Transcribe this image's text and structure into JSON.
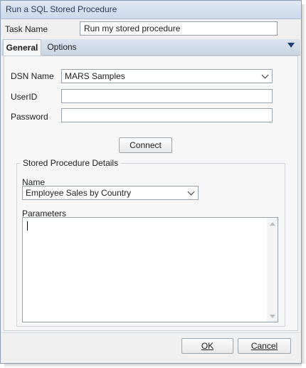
{
  "window": {
    "title": "Run a SQL Stored Procedure"
  },
  "task": {
    "label": "Task Name",
    "value": "Run my stored procedure"
  },
  "tabs": [
    {
      "label": "General"
    },
    {
      "label": "Options"
    }
  ],
  "connection": {
    "dsn_label": "DSN Name",
    "dsn_value": "MARS Samples",
    "userid_label": "UserID",
    "userid_value": "",
    "password_label": "Password",
    "password_value": "",
    "connect_label": "Connect"
  },
  "sp": {
    "group_title": "Stored Procedure Details",
    "name_label": "Name",
    "name_value": "Employee Sales by Country",
    "params_label": "Parameters",
    "params_value": ""
  },
  "footer": {
    "ok_label": "OK",
    "cancel_label": "Cancel"
  }
}
